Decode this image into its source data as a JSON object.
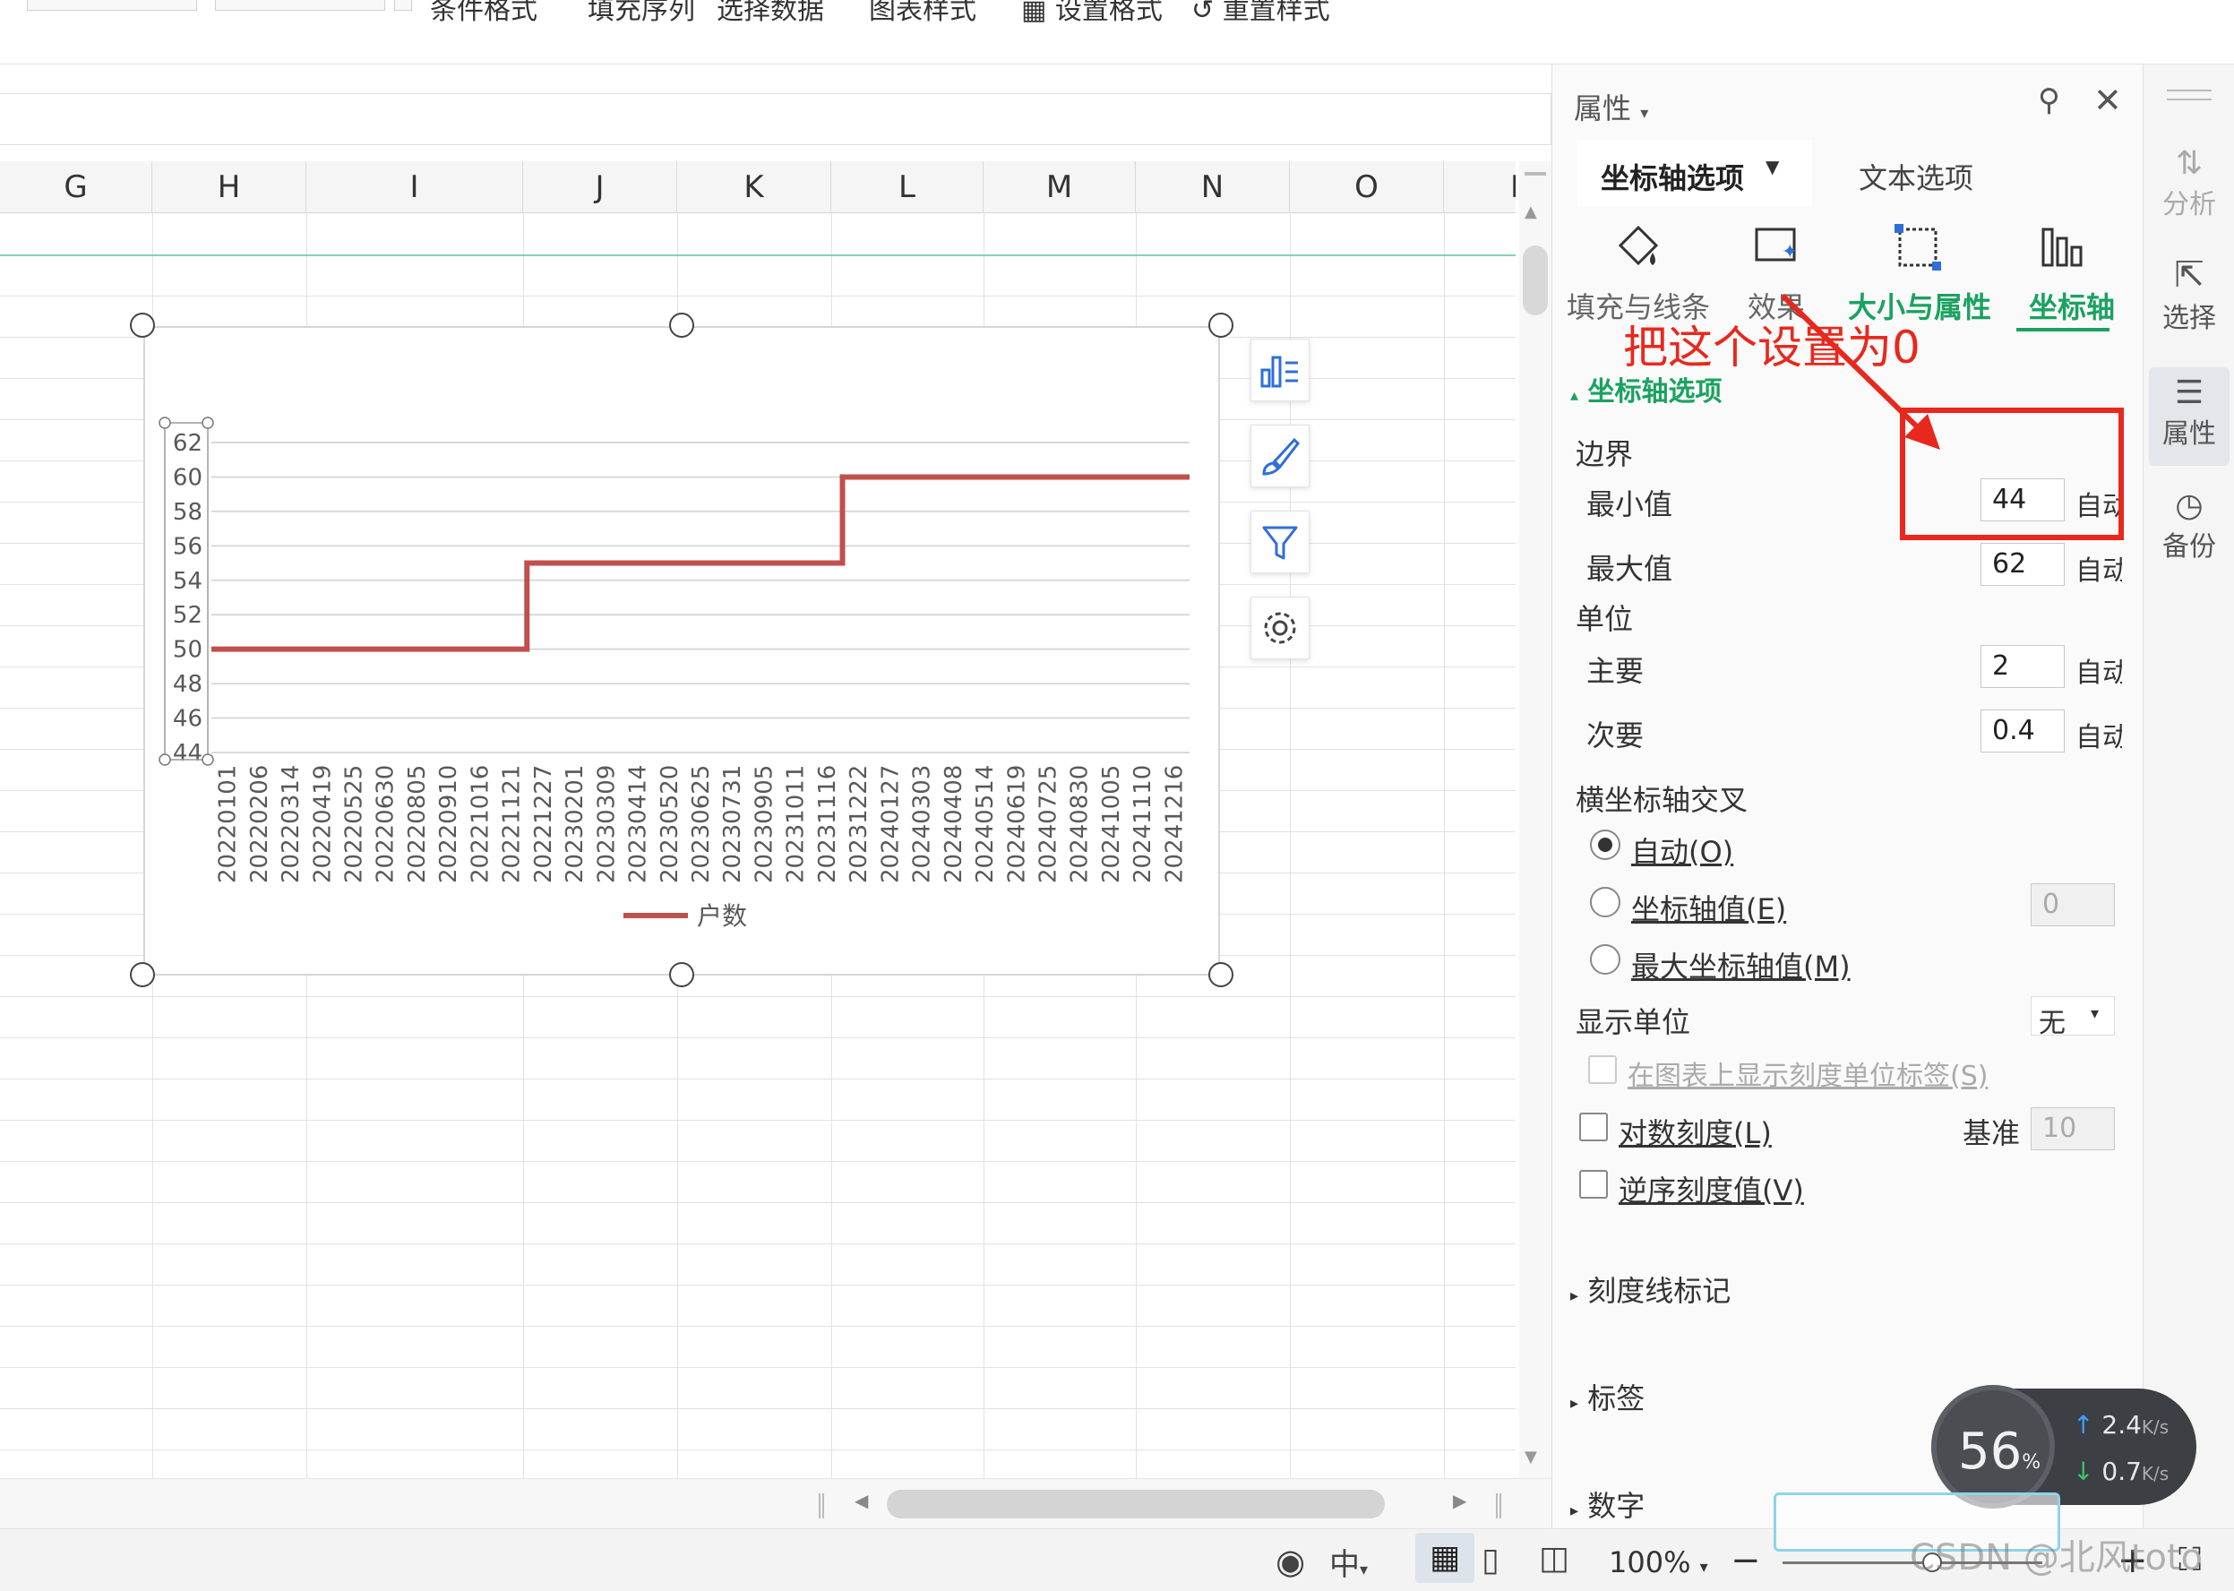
{
  "ribbon": {
    "items": [
      "条件格式",
      "填充序列",
      "选择数据",
      "图表样式",
      "设置格式",
      "重置样式"
    ]
  },
  "sheet": {
    "columns": [
      "G",
      "H",
      "I",
      "J",
      "K",
      "L",
      "M",
      "N",
      "O",
      "P"
    ]
  },
  "chart_data": {
    "type": "line",
    "title": "",
    "xlabel": "",
    "ylabel": "",
    "ylim": [
      44,
      62
    ],
    "yticks": [
      "62",
      "60",
      "58",
      "56",
      "54",
      "52",
      "50",
      "48",
      "46",
      "44"
    ],
    "categories": [
      "20220101",
      "20220206",
      "20220314",
      "20220419",
      "20220525",
      "20220630",
      "20220805",
      "20220910",
      "20221016",
      "20221121",
      "20221227",
      "20230201",
      "20230309",
      "20230414",
      "20230520",
      "20230625",
      "20230731",
      "20230905",
      "20231011",
      "20231116",
      "20231222",
      "20240127",
      "20240303",
      "20240408",
      "20240514",
      "20240619",
      "20240725",
      "20240830",
      "20241005",
      "20241110",
      "20241216"
    ],
    "series": [
      {
        "name": "户数",
        "color": "#c0504d",
        "values": [
          50,
          50,
          50,
          50,
          50,
          50,
          50,
          50,
          50,
          50,
          55,
          55,
          55,
          55,
          55,
          55,
          55,
          55,
          55,
          55,
          60,
          60,
          60,
          60,
          60,
          60,
          60,
          60,
          60,
          60,
          60
        ]
      }
    ],
    "legend": "bottom",
    "grid": true
  },
  "panel": {
    "title": "属性",
    "tabs": [
      "坐标轴选项",
      "文本选项"
    ],
    "subtabs": [
      "填充与线条",
      "效果",
      "大小与属性",
      "坐标轴"
    ],
    "section": "坐标轴选项",
    "bounds_label": "边界",
    "min_label": "最小值",
    "min_value": "44",
    "max_label": "最大值",
    "max_value": "62",
    "unit_label": "单位",
    "major_label": "主要",
    "major_value": "2",
    "minor_label": "次要",
    "minor_value": "0.4",
    "auto_label": "自动",
    "cross_label": "横坐标轴交叉",
    "radio_auto": "自动(O)",
    "radio_axis_value": "坐标轴值(E)",
    "axis_value": "0",
    "radio_max": "最大坐标轴值(M)",
    "display_unit_label": "显示单位",
    "display_unit_value": "无",
    "show_unit_label": "在图表上显示刻度单位标签(S)",
    "log_label": "对数刻度(L)",
    "base_label": "基准",
    "base_value": "10",
    "reverse_label": "逆序刻度值(V)",
    "tick_marks": "刻度线标记",
    "labels": "标签",
    "numbers": "数字"
  },
  "annotation": {
    "text": "把这个设置为0",
    "color": "#e8281d"
  },
  "rail": [
    "分析",
    "选择",
    "属性",
    "备份"
  ],
  "status": {
    "zoom": "100%",
    "input_method": "中"
  },
  "netmon": {
    "percent": "56",
    "percent_unit": "%",
    "up": "2.4",
    "down": "0.7",
    "speed_unit": "K/s"
  },
  "watermark": "CSDN @北风toto"
}
